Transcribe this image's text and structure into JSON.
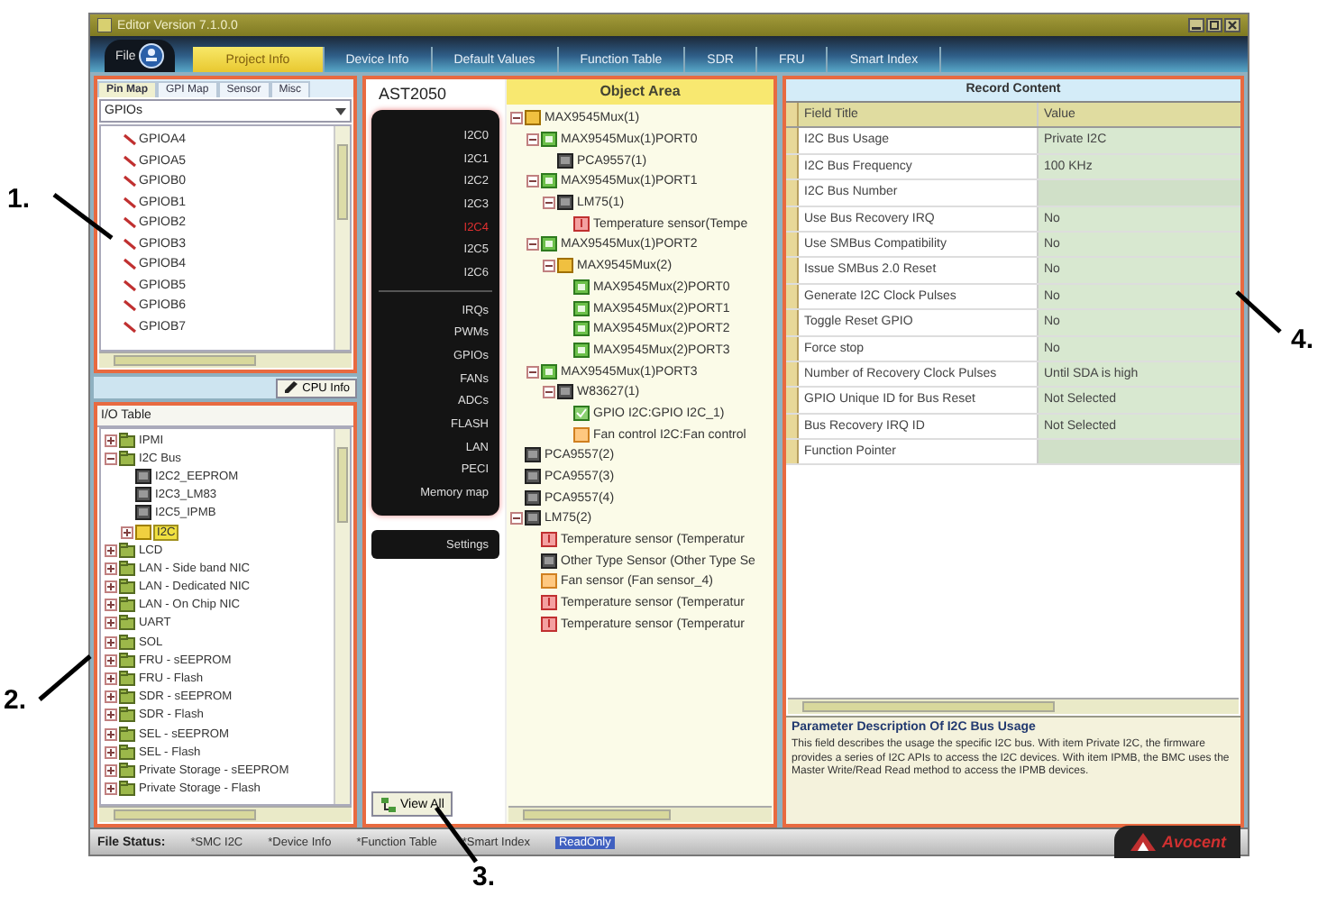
{
  "window": {
    "title": "Editor Version 7.1.0.0"
  },
  "file_menu": {
    "label": "File"
  },
  "tabs": [
    {
      "label": "Project Info",
      "selected": true
    },
    {
      "label": "Device Info",
      "selected": false
    },
    {
      "label": "Default Values",
      "selected": false
    },
    {
      "label": "Function Table",
      "selected": false
    },
    {
      "label": "SDR",
      "selected": false
    },
    {
      "label": "FRU",
      "selected": false
    },
    {
      "label": "Smart Index",
      "selected": false
    }
  ],
  "pin_panel": {
    "tabs": [
      {
        "label": "Pin Map",
        "selected": true
      },
      {
        "label": "GPI Map",
        "selected": false
      },
      {
        "label": "Sensor",
        "selected": false
      },
      {
        "label": "Misc",
        "selected": false
      }
    ],
    "dropdown": {
      "value": "GPIOs"
    },
    "items": [
      "GPIOA4",
      "GPIOA5",
      "GPIOB0",
      "GPIOB1",
      "GPIOB2",
      "GPIOB3",
      "GPIOB4",
      "GPIOB5",
      "GPIOB6",
      "GPIOB7"
    ]
  },
  "cpu_info_button": {
    "label": "CPU Info"
  },
  "io_table": {
    "title": "I/O Table",
    "tree": [
      {
        "label": "IPMI",
        "kind": "folder",
        "selected": false,
        "expanded": false
      },
      {
        "label": "I2C Bus",
        "kind": "folder",
        "selected": false,
        "expanded": true,
        "children": [
          {
            "label": "I2C2_EEPROM",
            "kind": "device",
            "selected": false
          },
          {
            "label": "I2C3_LM83",
            "kind": "device",
            "selected": false
          },
          {
            "label": "I2C5_IPMB",
            "kind": "device",
            "selected": false
          },
          {
            "label": "I2C",
            "kind": "port",
            "selected": true,
            "expanded": false
          }
        ]
      },
      {
        "label": "LCD",
        "kind": "folder",
        "selected": false,
        "expanded": false
      },
      {
        "label": "LAN - Side band NIC",
        "kind": "folder",
        "selected": false,
        "expanded": false
      },
      {
        "label": "LAN - Dedicated NIC",
        "kind": "folder",
        "selected": false,
        "expanded": false
      },
      {
        "label": "LAN - On Chip NIC",
        "kind": "folder",
        "selected": false,
        "expanded": false
      },
      {
        "label": "UART",
        "kind": "folder",
        "selected": false,
        "expanded": false
      },
      {
        "label": "SOL",
        "kind": "folder",
        "selected": false,
        "expanded": false
      },
      {
        "label": "FRU - sEEPROM",
        "kind": "folder",
        "selected": false,
        "expanded": false
      },
      {
        "label": "FRU - Flash",
        "kind": "folder",
        "selected": false,
        "expanded": false
      },
      {
        "label": "SDR - sEEPROM",
        "kind": "folder",
        "selected": false,
        "expanded": false
      },
      {
        "label": "SDR - Flash",
        "kind": "folder",
        "selected": false,
        "expanded": false
      },
      {
        "label": "SEL - sEEPROM",
        "kind": "folder",
        "selected": false,
        "expanded": false
      },
      {
        "label": "SEL - Flash",
        "kind": "folder",
        "selected": false,
        "expanded": false
      },
      {
        "label": "Private Storage - sEEPROM",
        "kind": "folder",
        "selected": false,
        "expanded": false
      },
      {
        "label": "Private Storage - Flash",
        "kind": "folder",
        "selected": false,
        "expanded": false
      }
    ]
  },
  "chip_panel": {
    "title": "AST2050",
    "buses": [
      {
        "label": "I2C0",
        "selected": false
      },
      {
        "label": "I2C1",
        "selected": false
      },
      {
        "label": "I2C2",
        "selected": false
      },
      {
        "label": "I2C3",
        "selected": false
      },
      {
        "label": "I2C4",
        "selected": true
      },
      {
        "label": "I2C5",
        "selected": false
      },
      {
        "label": "I2C6",
        "selected": false
      }
    ],
    "functions": [
      {
        "label": "IRQs",
        "selected": false
      },
      {
        "label": "PWMs",
        "selected": false
      },
      {
        "label": "GPIOs",
        "selected": false
      },
      {
        "label": "FANs",
        "selected": false
      },
      {
        "label": "ADCs",
        "selected": false
      },
      {
        "label": "FLASH",
        "selected": false
      },
      {
        "label": "LAN",
        "selected": false
      },
      {
        "label": "PECI",
        "selected": false
      },
      {
        "label": "Memory map",
        "selected": false
      }
    ],
    "settings_button": {
      "label": "Settings"
    },
    "view_all_button": {
      "label": "View All"
    }
  },
  "object_area": {
    "title": "Object Area",
    "tree": [
      {
        "label": "MAX9545Mux(1)",
        "kind": "root",
        "expanded": true,
        "children": [
          {
            "label": "MAX9545Mux(1)PORT0",
            "kind": "mux",
            "expanded": true,
            "children": [
              {
                "label": "PCA9557(1)",
                "kind": "device"
              }
            ]
          },
          {
            "label": "MAX9545Mux(1)PORT1",
            "kind": "mux",
            "expanded": true,
            "children": [
              {
                "label": "LM75(1)",
                "kind": "device",
                "expanded": true,
                "children": [
                  {
                    "label": "Temperature sensor(Tempe",
                    "kind": "sensor"
                  }
                ]
              }
            ]
          },
          {
            "label": "MAX9545Mux(1)PORT2",
            "kind": "mux",
            "expanded": true,
            "children": [
              {
                "label": "MAX9545Mux(2)",
                "kind": "root",
                "expanded": true,
                "children": [
                  {
                    "label": "MAX9545Mux(2)PORT0",
                    "kind": "mux"
                  },
                  {
                    "label": "MAX9545Mux(2)PORT1",
                    "kind": "mux"
                  },
                  {
                    "label": "MAX9545Mux(2)PORT2",
                    "kind": "mux"
                  },
                  {
                    "label": "MAX9545Mux(2)PORT3",
                    "kind": "mux"
                  }
                ]
              }
            ]
          },
          {
            "label": "MAX9545Mux(1)PORT3",
            "kind": "mux",
            "expanded": true,
            "children": [
              {
                "label": "W83627(1)",
                "kind": "device",
                "expanded": true,
                "children": [
                  {
                    "label": "GPIO I2C:GPIO I2C_1)",
                    "kind": "gpio"
                  },
                  {
                    "label": "Fan control I2C:Fan control",
                    "kind": "fan"
                  }
                ]
              }
            ]
          }
        ]
      },
      {
        "label": "PCA9557(2)",
        "kind": "device"
      },
      {
        "label": "PCA9557(3)",
        "kind": "device"
      },
      {
        "label": "PCA9557(4)",
        "kind": "device"
      },
      {
        "label": "LM75(2)",
        "kind": "device",
        "expanded": true,
        "children": [
          {
            "label": "Temperature sensor (Temperatur",
            "kind": "sensor"
          },
          {
            "label": "Other Type Sensor (Other Type Se",
            "kind": "device"
          },
          {
            "label": "Fan sensor (Fan sensor_4)",
            "kind": "fan"
          },
          {
            "label": "Temperature sensor (Temperatur",
            "kind": "sensor"
          },
          {
            "label": "Temperature sensor (Temperatur",
            "kind": "sensor"
          }
        ]
      }
    ]
  },
  "record_content": {
    "title": "Record Content",
    "columns": [
      "Field Title",
      "Value"
    ],
    "rows": [
      {
        "field": "I2C Bus Usage",
        "value": "Private I2C"
      },
      {
        "field": "I2C Bus Frequency",
        "value": "100 KHz"
      },
      {
        "field": "I2C Bus Number"
      },
      {
        "field": "Use Bus Recovery IRQ",
        "value": "No"
      },
      {
        "field": "Use SMBus Compatibility",
        "value": "No"
      },
      {
        "field": "Issue SMBus 2.0 Reset",
        "value": "No"
      },
      {
        "field": "Generate I2C Clock Pulses",
        "value": "No"
      },
      {
        "field": "Toggle Reset GPIO",
        "value": "No"
      },
      {
        "field": "Force stop",
        "value": "No"
      },
      {
        "field": "Number of Recovery Clock Pulses",
        "value": "Until SDA is high"
      },
      {
        "field": "GPIO Unique ID for Bus Reset",
        "value": "Not Selected"
      },
      {
        "field": "Bus Recovery IRQ ID",
        "value": "Not Selected"
      },
      {
        "field": "Function Pointer"
      }
    ]
  },
  "description": {
    "title": "Parameter Description Of I2C Bus Usage",
    "text": "This field describes the usage the specific I2C bus. With item Private I2C, the firmware provides a series of I2C APIs to access the I2C devices. With item IPMB, the BMC uses the Master Write/Read Read method to access the IPMB devices."
  },
  "status_bar": {
    "items": [
      {
        "text": "File Status:",
        "kind": "label"
      },
      {
        "text": "*SMC I2C",
        "kind": "field"
      },
      {
        "text": "*Device Info",
        "kind": "field"
      },
      {
        "text": "*Function Table",
        "kind": "field"
      },
      {
        "text": "*Smart Index",
        "kind": "field"
      },
      {
        "text": "ReadOnly",
        "kind": "mode"
      }
    ]
  },
  "logo": {
    "text": "Avocent"
  },
  "callouts": [
    "1.",
    "2.",
    "3.",
    "4."
  ]
}
